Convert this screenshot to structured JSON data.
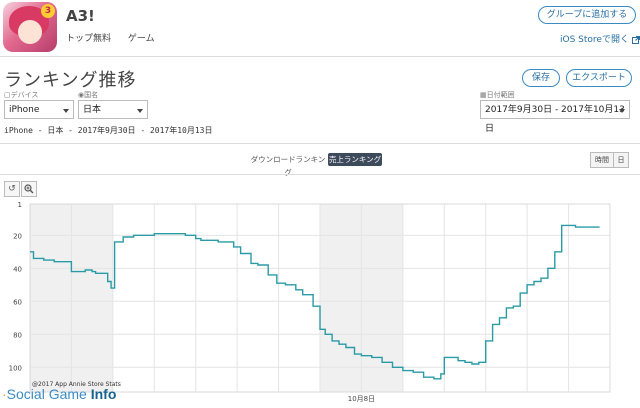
{
  "app": {
    "name": "A3!",
    "badge": "3",
    "meta": [
      "トップ無料",
      "ゲーム"
    ],
    "add_group_label": "グループに追加する",
    "ios_store_label": "iOS Storeで開く",
    "ios_store_icon": "external-link-icon"
  },
  "ranking": {
    "title": "ランキング推移",
    "save_label": "保存",
    "export_label": "エクスポート"
  },
  "filters": {
    "device_label": "デバイス",
    "device_value": "iPhone",
    "country_label": "国名",
    "country_value": "日本",
    "date_label": "日付範囲",
    "date_value": "2017年9月30日 - 2017年10月13日"
  },
  "summary": "iPhone - 日本 - 2017年9月30日 - 2017年10月13日",
  "tabs": {
    "download": "ダウンロードランキング",
    "revenue": "売上ランキング"
  },
  "granularity": [
    "時間",
    "日"
  ],
  "tools": {
    "reset_icon": "undo-icon",
    "zoom_icon": "zoom-icon"
  },
  "copyright": "@2017 App Annie Store Stats",
  "watermark": {
    "part1": "Social Game",
    "part2": "Info"
  },
  "colors": {
    "line": "#2a9aa6",
    "accent": "#2a6fa3",
    "shade": "#f0f0f0"
  },
  "chart_data": {
    "type": "line",
    "title": "",
    "xlabel": "",
    "ylabel": "",
    "y_inverted": true,
    "ylim": [
      1,
      115
    ],
    "yticks": [
      1,
      20,
      40,
      60,
      80,
      100
    ],
    "xlim": [
      "2017-09-30 00:00",
      "2017-10-14 00:00"
    ],
    "xtick_labels": [
      {
        "x": "2017-10-08 00:00",
        "label": "10月8日"
      }
    ],
    "shaded_ranges": [
      [
        "2017-09-30 00:00",
        "2017-10-02 00:00"
      ],
      [
        "2017-10-07 00:00",
        "2017-10-09 00:00"
      ]
    ],
    "grid": true,
    "legend": "none",
    "series": [
      {
        "x": [
          "2017-09-30 00:00",
          "2017-09-30 02:00",
          "2017-09-30 08:00",
          "2017-09-30 14:00",
          "2017-09-30 20:00",
          "2017-10-01 00:00",
          "2017-10-01 04:00",
          "2017-10-01 08:00",
          "2017-10-01 12:00",
          "2017-10-01 14:00",
          "2017-10-01 18:00",
          "2017-10-01 21:00",
          "2017-10-01 23:00",
          "2017-10-02 01:00",
          "2017-10-02 06:00",
          "2017-10-02 12:00",
          "2017-10-02 18:00",
          "2017-10-03 00:00",
          "2017-10-03 06:00",
          "2017-10-03 12:00",
          "2017-10-03 18:00",
          "2017-10-04 00:00",
          "2017-10-04 03:00",
          "2017-10-04 08:00",
          "2017-10-04 13:00",
          "2017-10-04 18:00",
          "2017-10-04 22:00",
          "2017-10-05 02:00",
          "2017-10-05 08:00",
          "2017-10-05 12:00",
          "2017-10-05 18:00",
          "2017-10-05 23:00",
          "2017-10-06 04:00",
          "2017-10-06 10:00",
          "2017-10-06 14:00",
          "2017-10-06 20:00",
          "2017-10-07 00:00",
          "2017-10-07 03:00",
          "2017-10-07 07:00",
          "2017-10-07 11:00",
          "2017-10-07 15:00",
          "2017-10-07 20:00",
          "2017-10-08 00:00",
          "2017-10-08 06:00",
          "2017-10-08 12:00",
          "2017-10-08 18:00",
          "2017-10-09 00:00",
          "2017-10-09 06:00",
          "2017-10-09 12:00",
          "2017-10-09 18:00",
          "2017-10-09 22:00",
          "2017-10-10 00:00",
          "2017-10-10 04:00",
          "2017-10-10 08:00",
          "2017-10-10 12:00",
          "2017-10-10 16:00",
          "2017-10-10 20:00",
          "2017-10-11 00:00",
          "2017-10-11 04:00",
          "2017-10-11 08:00",
          "2017-10-11 12:00",
          "2017-10-11 16:00",
          "2017-10-11 20:00",
          "2017-10-12 00:00",
          "2017-10-12 04:00",
          "2017-10-12 08:00",
          "2017-10-12 12:00",
          "2017-10-12 16:00",
          "2017-10-12 20:00",
          "2017-10-13 00:00",
          "2017-10-13 04:00",
          "2017-10-13 08:00",
          "2017-10-13 12:00",
          "2017-10-13 18:00"
        ],
        "values": [
          30,
          34,
          35,
          36,
          36,
          42,
          42,
          41,
          42,
          43,
          43,
          48,
          52,
          24,
          21,
          20,
          20,
          19,
          19,
          19,
          20,
          22,
          23,
          23,
          24,
          24,
          27,
          31,
          37,
          38,
          44,
          49,
          50,
          53,
          56,
          63,
          77,
          80,
          84,
          86,
          88,
          92,
          93,
          94,
          97,
          100,
          102,
          103,
          106,
          107,
          104,
          94,
          94,
          96,
          97,
          98,
          97,
          84,
          74,
          70,
          64,
          63,
          55,
          50,
          48,
          46,
          40,
          30,
          14,
          14,
          15,
          15,
          15,
          15
        ]
      }
    ]
  }
}
